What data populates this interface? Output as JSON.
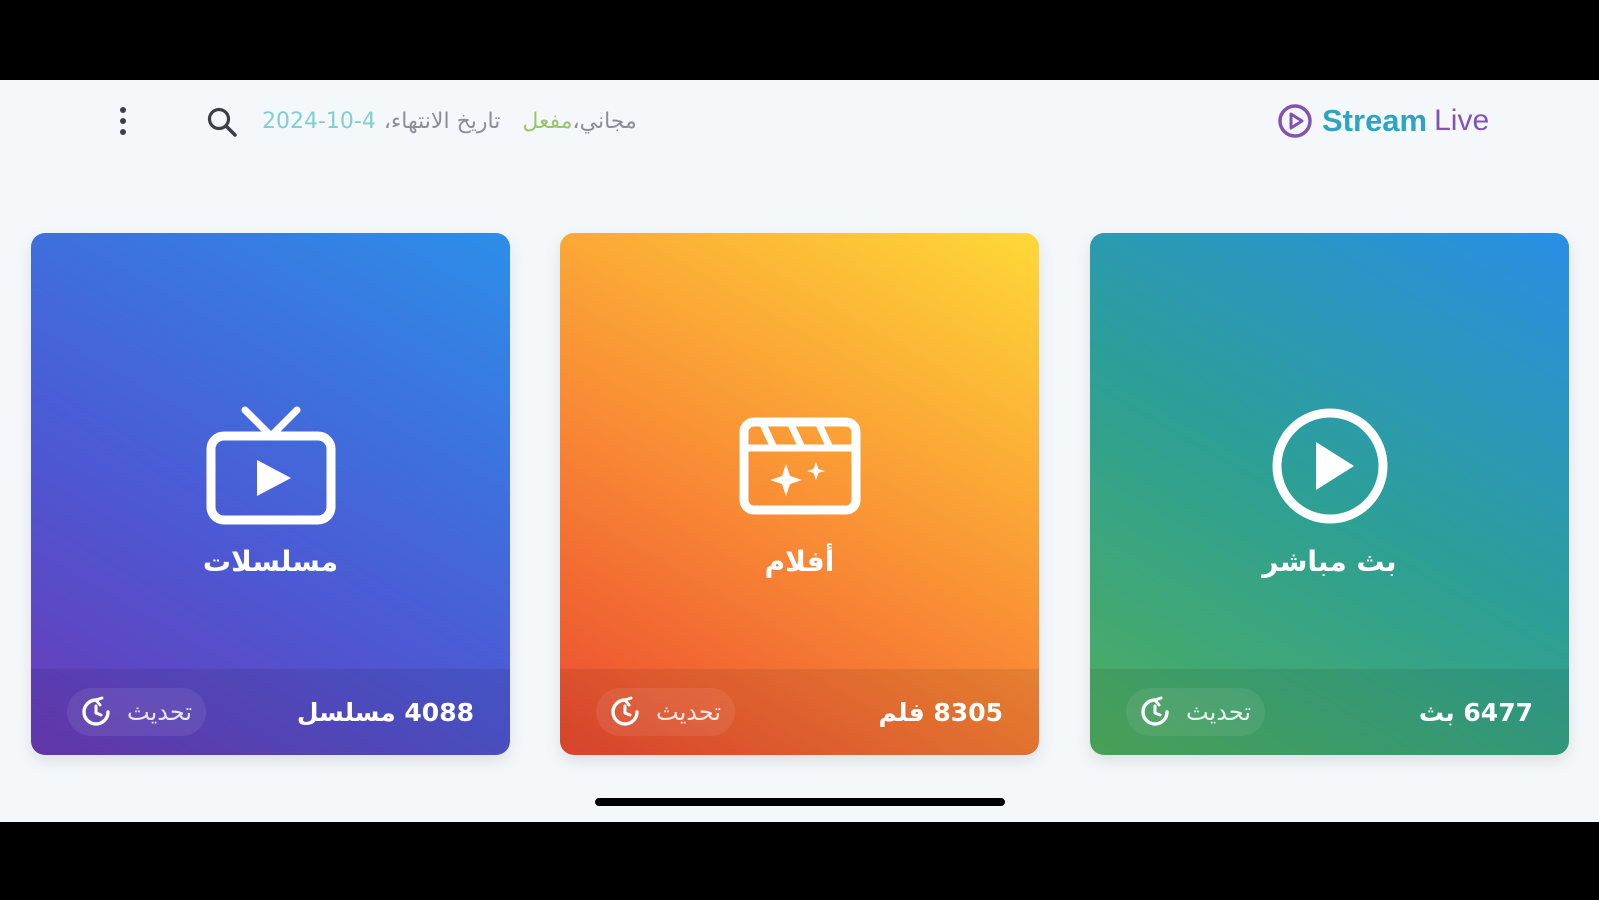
{
  "brand": {
    "word1": "Stream",
    "word2": "Live",
    "icon": "play-circle-icon"
  },
  "status": {
    "plan": "مجاني",
    "separator": "،",
    "state": "مفعل",
    "expiry_label": "تاريخ الانتهاء،",
    "expiry_date": "2024-10-4"
  },
  "toolbar": {
    "search_icon": "search-icon",
    "menu_icon": "more-vertical-icon"
  },
  "cards": [
    {
      "id": "live",
      "title": "بث مباشر",
      "count": "6477 بث",
      "refresh_label": "تحديث",
      "icon": "play-circle-icon"
    },
    {
      "id": "movies",
      "title": "أفلام",
      "count": "8305 فلم",
      "refresh_label": "تحديث",
      "icon": "clapperboard-icon"
    },
    {
      "id": "series",
      "title": "مسلسلات",
      "count": "4088 مسلسل",
      "refresh_label": "تحديث",
      "icon": "tv-play-icon"
    }
  ],
  "colors": {
    "background": "#f5f8fb",
    "brand_primary": "#2ea3c4",
    "brand_secondary": "#8352b3",
    "status_active": "#9bc46a",
    "series_gradient": [
      "#6a3ab6",
      "#2c8ee9"
    ],
    "movies_gradient": [
      "#ea4830",
      "#fed937"
    ],
    "live_gradient": [
      "#4fae5c",
      "#2a8ee5"
    ]
  }
}
